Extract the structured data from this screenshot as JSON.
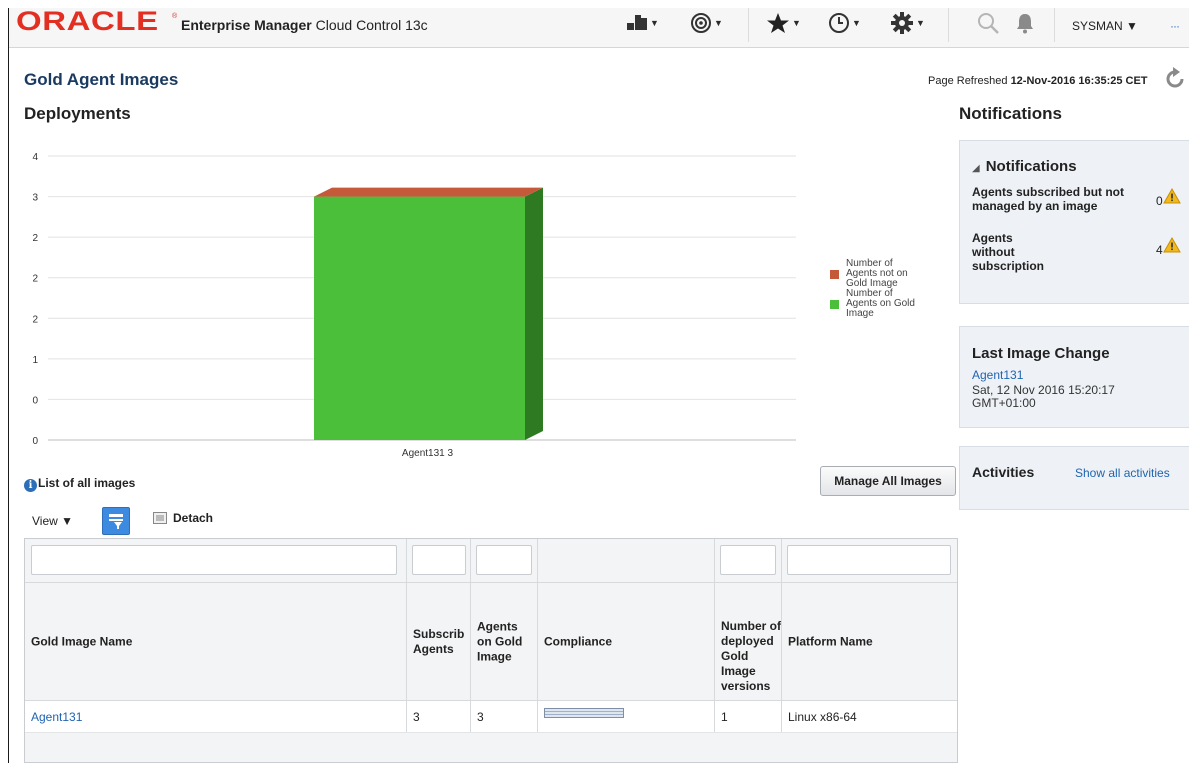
{
  "header": {
    "brand": "ORACLE",
    "product_bold": "Enterprise Manager",
    "product_rest": "Cloud Control 13c",
    "user": "SYSMAN ▼",
    "more": "···"
  },
  "page": {
    "title": "Gold Agent Images",
    "refresh_label": "Page Refreshed",
    "refresh_time": "12-Nov-2016 16:35:25 CET"
  },
  "deployments": {
    "heading": "Deployments"
  },
  "chart_data": {
    "type": "bar",
    "categories": [
      "Agent131 3"
    ],
    "series": [
      {
        "name": "Number of Agents on Gold Image",
        "values": [
          3
        ],
        "color": "#4cbf3a"
      },
      {
        "name": "Number of Agents not on Gold Image",
        "values": [
          0
        ],
        "color": "#c55a3a"
      }
    ],
    "y_tick_labels": [
      "0",
      "0",
      "1",
      "2",
      "2",
      "2",
      "3",
      "4"
    ],
    "ylim": [
      0,
      3.5
    ],
    "stacked": true,
    "legend_position": "right",
    "grid": true
  },
  "legend": {
    "not_on_gold": [
      "Number of",
      "Agents not on",
      "Gold Image"
    ],
    "on_gold": [
      "Number of",
      "Agents on Gold",
      "Image"
    ]
  },
  "notifications": {
    "heading": "Notifications",
    "box_title": "Notifications",
    "subscribed_label": [
      "Agents subscribed but not",
      "managed by an image"
    ],
    "subscribed_count": "0",
    "without_label": [
      "Agents",
      "without",
      "subscription"
    ],
    "without_count": "4"
  },
  "last_change": {
    "title": "Last Image Change",
    "link": "Agent131",
    "date": "Sat, 12 Nov 2016 15:20:17 GMT+01:00"
  },
  "activities": {
    "title": "Activities",
    "link": "Show all activities"
  },
  "list": {
    "caption": "List of all images",
    "info_glyph": "i",
    "manage_button": "Manage All Images",
    "view_menu": "View ▼",
    "detach": "Detach"
  },
  "table": {
    "columns": [
      "Gold Image Name",
      "Subscrib Agents",
      "Agents on Gold Image",
      "Compliance",
      "Number of deployed Gold Image versions",
      "Platform Name"
    ],
    "rows": [
      {
        "name": "Agent131",
        "subscribed": "3",
        "on_gold": "3",
        "compliance_fraction": 1.0,
        "versions": "1",
        "platform": "Linux x86-64"
      }
    ]
  },
  "colors": {
    "oracle_red": "#e32f22",
    "link_blue": "#2064b0",
    "bar_green": "#4cbf3a",
    "bar_red": "#c55a3a",
    "panel_bg": "#eef2f6"
  },
  "icons": [
    "targets-menu-icon",
    "target-selector-icon",
    "favorites-star-icon",
    "history-clock-icon",
    "setup-gear-icon",
    "search-icon",
    "notifications-bell-icon",
    "refresh-icon",
    "warning-icon",
    "info-icon",
    "query-by-example-icon",
    "detach-icon"
  ]
}
